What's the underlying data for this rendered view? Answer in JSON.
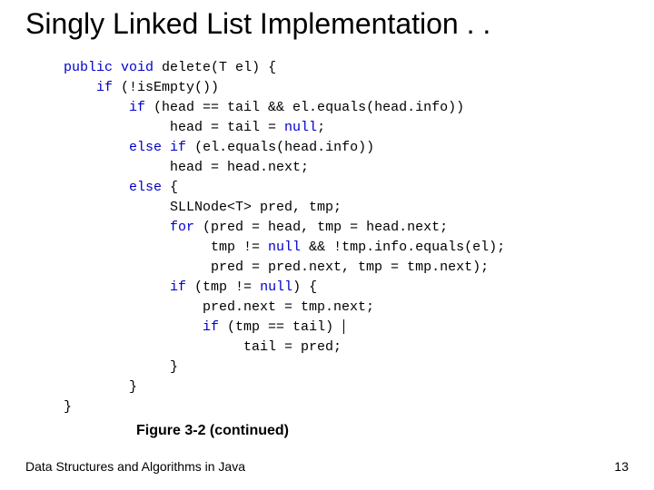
{
  "title": "Singly Linked List Implementation . .",
  "code": {
    "l1a": "public",
    "l1b": " ",
    "l1c": "void",
    "l1d": " delete(T el) {",
    "l2a": "    ",
    "l2b": "if",
    "l2c": " (!isEmpty())",
    "l3a": "        ",
    "l3b": "if",
    "l3c": " (head == tail && el.equals(head.info))",
    "l4": "             head = tail = ",
    "l4b": "null",
    "l4c": ";",
    "l5a": "        ",
    "l5b": "else",
    "l5c": " ",
    "l5d": "if",
    "l5e": " (el.equals(head.info))",
    "l6": "             head = head.next;",
    "l7a": "        ",
    "l7b": "else",
    "l7c": " {",
    "l8": "             SLLNode<T> pred, tmp;",
    "l9a": "             ",
    "l9b": "for",
    "l9c": " (pred = head, tmp = head.next;",
    "l10a": "                  tmp != ",
    "l10b": "null",
    "l10c": " && !tmp.info.equals(el);",
    "l11": "                  pred = pred.next, tmp = tmp.next);",
    "l12a": "             ",
    "l12b": "if",
    "l12c": " (tmp != ",
    "l12d": "null",
    "l12e": ") {",
    "l13": "                 pred.next = tmp.next;",
    "l14a": "                 ",
    "l14b": "if",
    "l14c": " (tmp == tail) ",
    "l15": "                      tail = pred;",
    "l16": "             }",
    "l17": "        }",
    "l18": "}"
  },
  "caption": "Figure 3-2   (continued)",
  "footer_left": "Data Structures and Algorithms in Java",
  "page_number": "13"
}
